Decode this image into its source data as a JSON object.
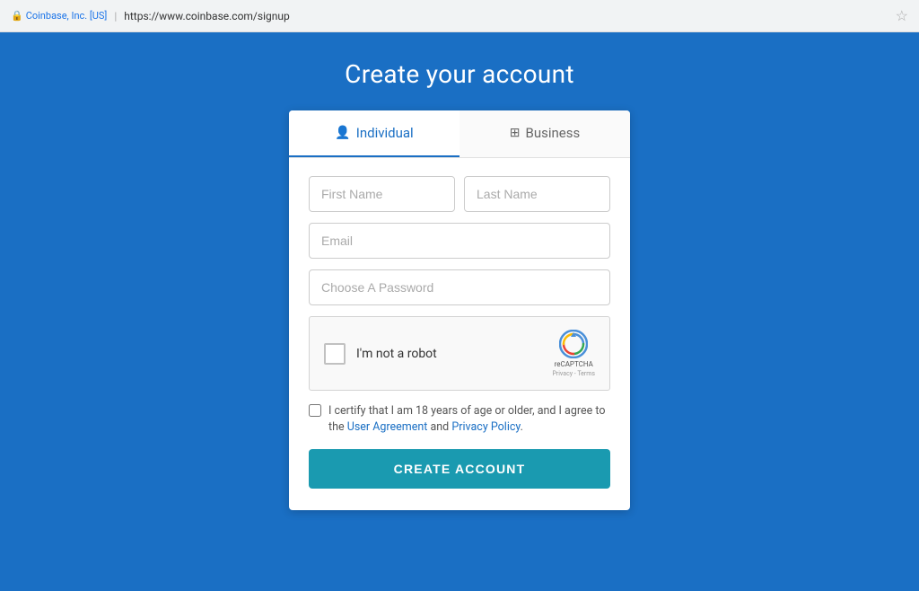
{
  "browser": {
    "lock_symbol": "🔒",
    "site_name": "Coinbase, Inc. [US]",
    "url": "https://www.coinbase.com/signup",
    "divider": "|",
    "star_symbol": "☆"
  },
  "page": {
    "title": "Create your account",
    "background_color": "#1a6fc4"
  },
  "tabs": [
    {
      "id": "individual",
      "label": "Individual",
      "active": true
    },
    {
      "id": "business",
      "label": "Business",
      "active": false
    }
  ],
  "form": {
    "first_name_placeholder": "First Name",
    "last_name_placeholder": "Last Name",
    "email_placeholder": "Email",
    "password_placeholder": "Choose A Password",
    "recaptcha_label": "I'm not a robot",
    "recaptcha_branding": "reCAPTCHA",
    "recaptcha_links": "Privacy - Terms",
    "terms_text": "I certify that I am 18 years of age or older, and I agree to the",
    "terms_link1": "User Agreement",
    "terms_and": "and",
    "terms_link2": "Privacy Policy",
    "terms_period": ".",
    "create_button_label": "CREATE ACCOUNT"
  }
}
